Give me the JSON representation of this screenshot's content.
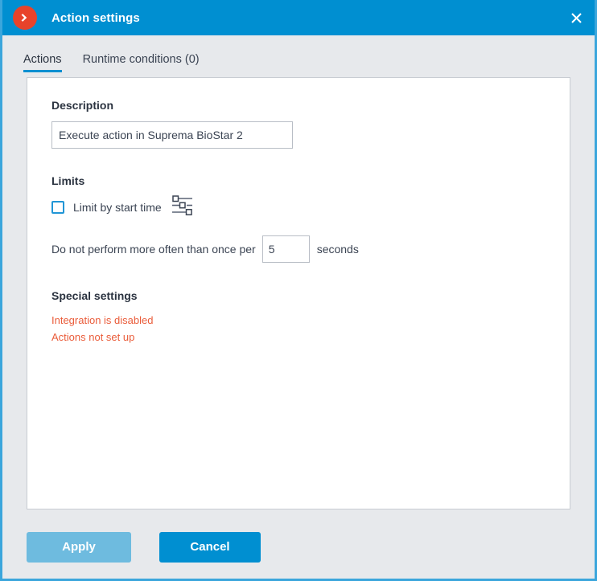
{
  "window": {
    "title": "Action settings",
    "app_icon": "chevron-right-circle-icon",
    "close_icon": "close-icon",
    "accent_color": "#008fd1",
    "icon_color": "#e8432a",
    "border_color": "#3ba6dc",
    "background_color": "#e7e9ec"
  },
  "tabs": [
    {
      "label": "Actions",
      "active": true
    },
    {
      "label": "Runtime conditions (0)",
      "active": false
    }
  ],
  "main": {
    "description": {
      "heading": "Description",
      "value": "Execute action in Suprema BioStar 2",
      "placeholder": "Description"
    },
    "limits": {
      "heading": "Limits",
      "limit_by_start_time": {
        "label": "Limit by start time",
        "checked": false,
        "settings_icon": "sliders-icon"
      },
      "rate_limit": {
        "prefix": "Do not perform more often than once per",
        "value": "5",
        "suffix": "seconds"
      }
    },
    "special_settings": {
      "heading": "Special settings",
      "messages": [
        "Integration is disabled",
        "Actions not set up"
      ],
      "message_color": "#ea5c3a"
    }
  },
  "footer": {
    "apply_label": "Apply",
    "cancel_label": "Cancel",
    "apply_color": "#6ebbdf",
    "cancel_color": "#008fd1"
  }
}
